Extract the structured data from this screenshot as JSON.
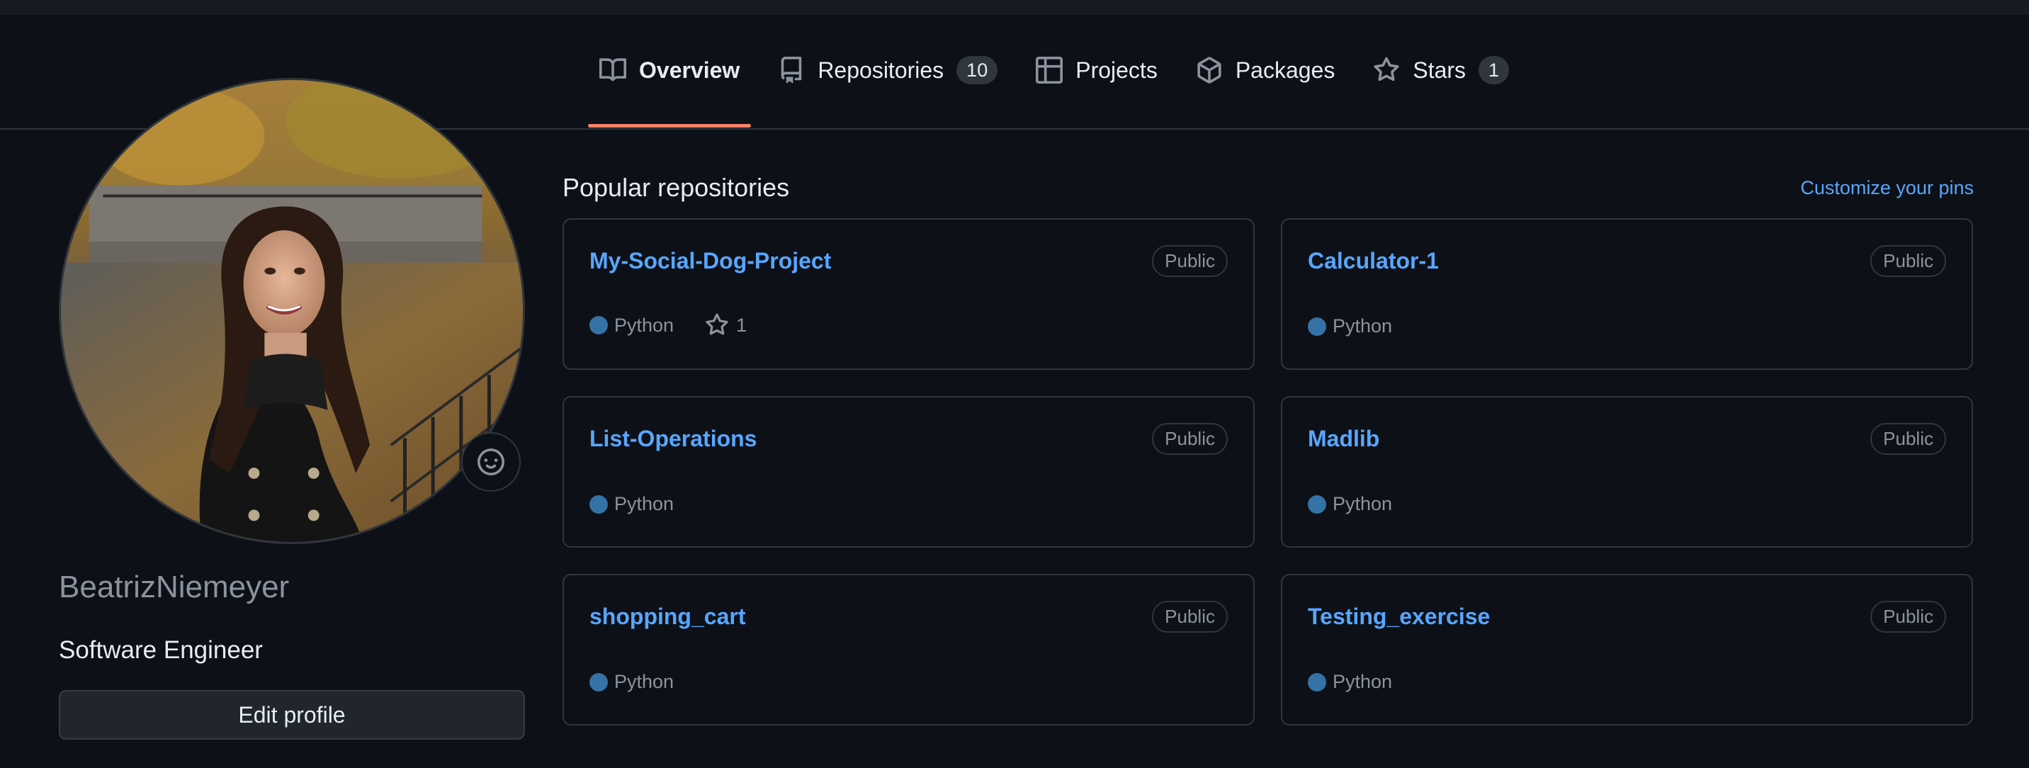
{
  "nav": {
    "tabs": [
      {
        "label": "Overview",
        "icon": "book-icon",
        "active": true
      },
      {
        "label": "Repositories",
        "icon": "repo-icon",
        "count": "10"
      },
      {
        "label": "Projects",
        "icon": "table-icon"
      },
      {
        "label": "Packages",
        "icon": "package-icon"
      },
      {
        "label": "Stars",
        "icon": "star-icon",
        "count": "1"
      }
    ]
  },
  "profile": {
    "username": "BeatrizNiemeyer",
    "bio": "Software Engineer",
    "edit_label": "Edit profile",
    "status_icon": "smiley-icon"
  },
  "popular": {
    "title": "Popular repositories",
    "customize_label": "Customize your pins",
    "repos": [
      {
        "name": "My-Social-Dog-Project",
        "visibility": "Public",
        "language": "Python",
        "stars": "1"
      },
      {
        "name": "Calculator-1",
        "visibility": "Public",
        "language": "Python"
      },
      {
        "name": "List-Operations",
        "visibility": "Public",
        "language": "Python"
      },
      {
        "name": "Madlib",
        "visibility": "Public",
        "language": "Python"
      },
      {
        "name": "shopping_cart",
        "visibility": "Public",
        "language": "Python"
      },
      {
        "name": "Testing_exercise",
        "visibility": "Public",
        "language": "Python"
      }
    ]
  },
  "colors": {
    "background": "#0d1117",
    "link": "#58a6ff",
    "python": "#3572a5",
    "active_tab_underline": "#f78166"
  }
}
